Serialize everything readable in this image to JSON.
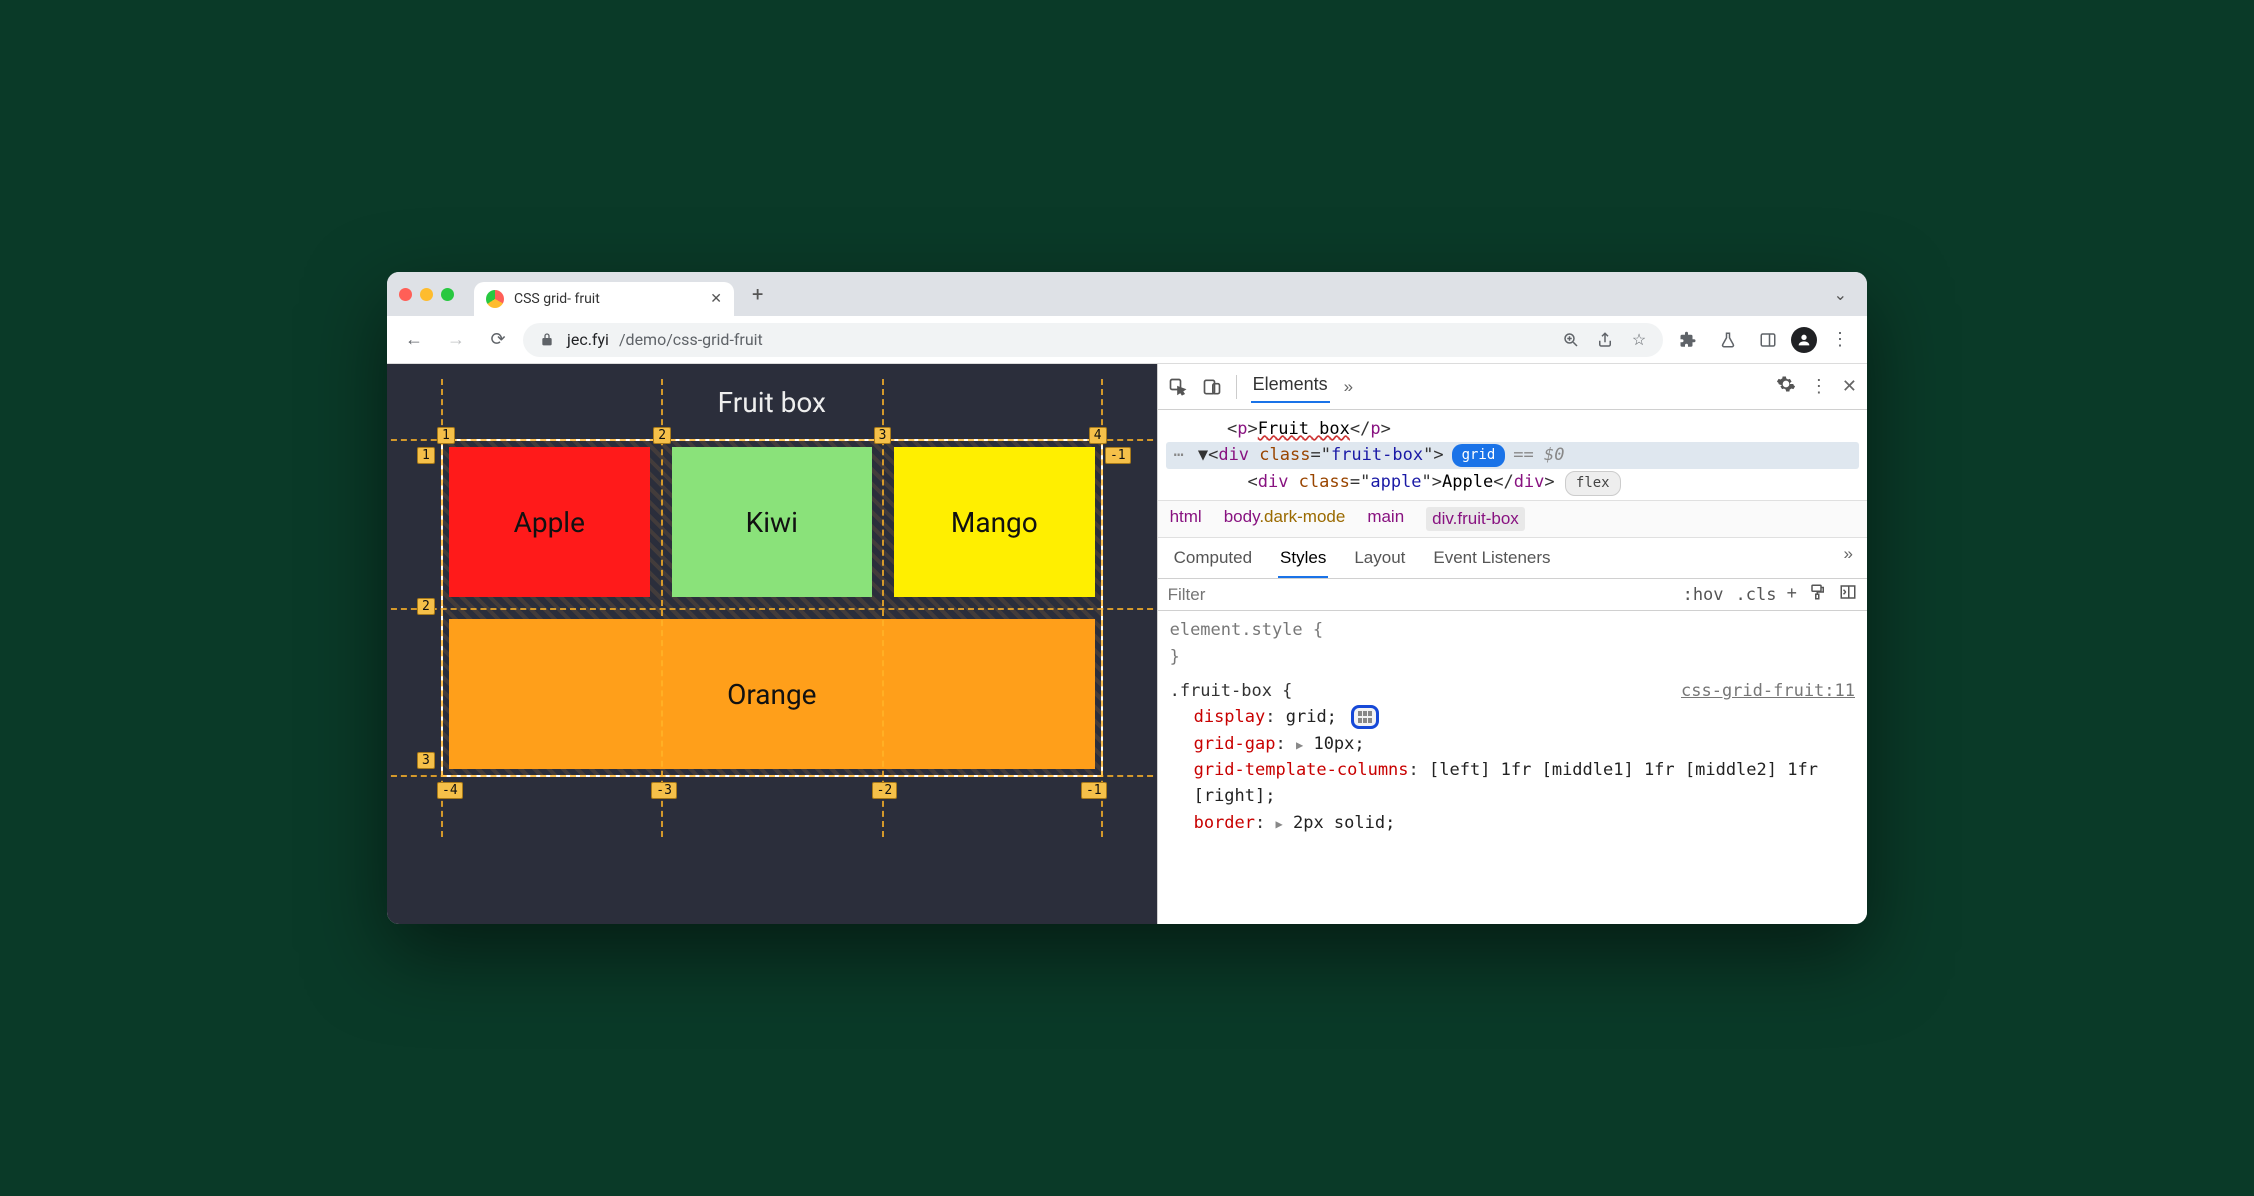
{
  "tab": {
    "title": "CSS grid- fruit"
  },
  "url": {
    "host": "jec.fyi",
    "path": "/demo/css-grid-fruit"
  },
  "page": {
    "heading": "Fruit box",
    "cells": {
      "apple": "Apple",
      "kiwi": "Kiwi",
      "mango": "Mango",
      "orange": "Orange"
    },
    "col_lines": [
      "1",
      "2",
      "3",
      "4"
    ],
    "row_lines_left": [
      "1",
      "2",
      "3"
    ],
    "neg_row_right": "-1",
    "neg_cols_bottom": [
      "-4",
      "-3",
      "-2",
      "-1"
    ]
  },
  "devtools": {
    "panel": "Elements",
    "dom": {
      "p_text": "Fruit box",
      "sel_class": "fruit-box",
      "sel_badge": "grid",
      "sel_suffix": "== $0",
      "child_class": "apple",
      "child_text": "Apple",
      "child_badge": "flex"
    },
    "breadcrumbs": [
      "html",
      "body",
      ".dark-mode",
      "main",
      "div.fruit-box"
    ],
    "subtabs": [
      "Computed",
      "Styles",
      "Layout",
      "Event Listeners"
    ],
    "filter_placeholder": "Filter",
    "chips": [
      ":hov",
      ".cls"
    ],
    "styles": {
      "inline_label": "element.style {",
      "inline_close": "}",
      "selector": ".fruit-box {",
      "source": "css-grid-fruit:11",
      "props": [
        {
          "name": "display",
          "value": "grid;",
          "editor": true
        },
        {
          "name": "grid-gap",
          "value": "10px;",
          "expand": true
        },
        {
          "name": "grid-template-columns",
          "value": "[left] 1fr [middle1] 1fr [middle2] 1fr [right];"
        },
        {
          "name": "border",
          "value": "2px solid;",
          "expand": true
        }
      ]
    }
  }
}
